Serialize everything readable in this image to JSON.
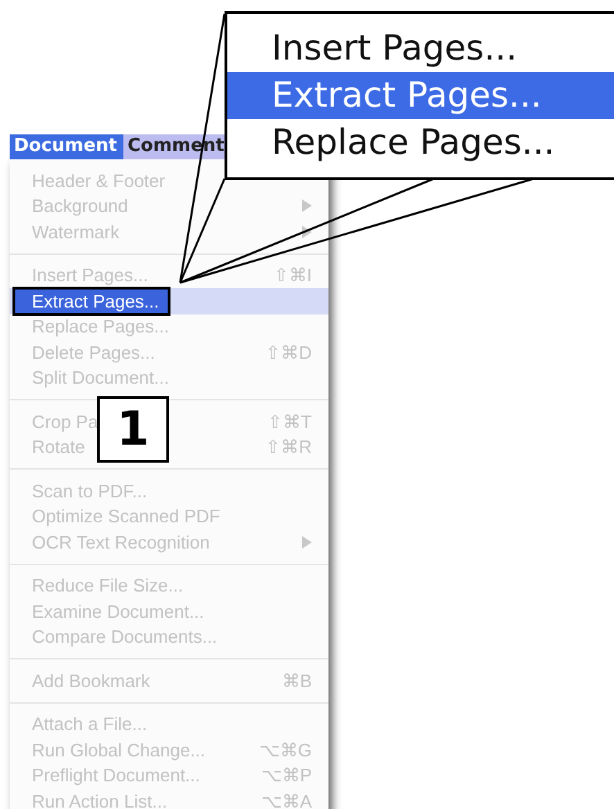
{
  "menu_bar": [
    {
      "label": "Document",
      "selected": true
    },
    {
      "label": "Comment",
      "selected": false
    }
  ],
  "menu": {
    "groups": [
      [
        {
          "label": "Header & Footer",
          "disabled": true,
          "selected": false
        },
        {
          "label": "Background",
          "disabled": true,
          "selected": false,
          "submenu": true
        },
        {
          "label": "Watermark",
          "disabled": true,
          "selected": false,
          "submenu": true
        }
      ],
      [
        {
          "label": "Insert Pages...",
          "shortcut": "⇧⌘I",
          "disabled": true,
          "selected": false
        },
        {
          "label": "Extract Pages...",
          "disabled": false,
          "selected": true
        },
        {
          "label": "Replace Pages...",
          "disabled": true,
          "selected": false
        },
        {
          "label": "Delete Pages...",
          "shortcut": "⇧⌘D",
          "disabled": true,
          "selected": false
        },
        {
          "label": "Split Document...",
          "disabled": true,
          "selected": false
        }
      ],
      [
        {
          "label": "Crop Pa",
          "shortcut": "⇧⌘T",
          "disabled": true,
          "selected": false
        },
        {
          "label": "Rotate",
          "shortcut": "⇧⌘R",
          "disabled": true,
          "selected": false
        }
      ],
      [
        {
          "label": "Scan to PDF...",
          "disabled": true,
          "selected": false
        },
        {
          "label": "Optimize Scanned PDF",
          "disabled": true,
          "selected": false
        },
        {
          "label": "OCR Text Recognition",
          "disabled": true,
          "selected": false,
          "submenu": true
        }
      ],
      [
        {
          "label": "Reduce File Size...",
          "disabled": true,
          "selected": false
        },
        {
          "label": "Examine Document...",
          "disabled": true,
          "selected": false
        },
        {
          "label": "Compare Documents...",
          "disabled": true,
          "selected": false
        }
      ],
      [
        {
          "label": "Add Bookmark",
          "shortcut": "⌘B",
          "disabled": true,
          "selected": false
        }
      ],
      [
        {
          "label": "Attach a File...",
          "disabled": true,
          "selected": false
        },
        {
          "label": "Run Global Change...",
          "shortcut": "⌥⌘G",
          "disabled": true,
          "selected": false
        },
        {
          "label": "Preflight Document...",
          "shortcut": "⌥⌘P",
          "disabled": true,
          "selected": false
        },
        {
          "label": "Run Action List...",
          "shortcut": "⌥⌘A",
          "disabled": true,
          "selected": false
        }
      ]
    ]
  },
  "callout": {
    "items": [
      {
        "label": "Insert Pages...",
        "selected": false
      },
      {
        "label": "Extract Pages...",
        "selected": true
      },
      {
        "label": "Replace Pages...",
        "selected": false
      }
    ]
  },
  "step_badge": "1"
}
